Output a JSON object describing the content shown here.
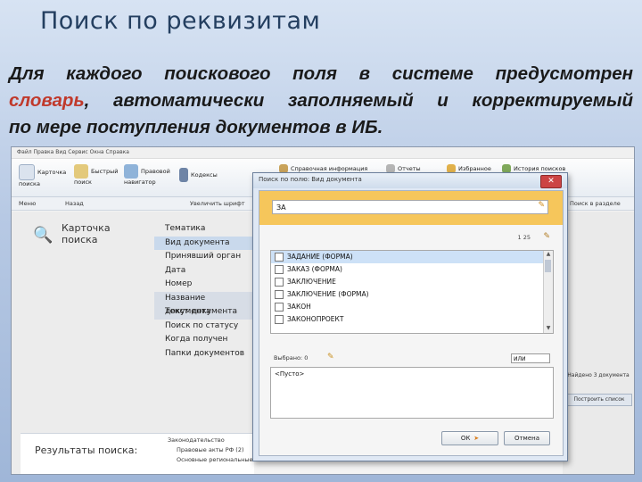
{
  "slide": {
    "title": "Поиск по реквизитам",
    "intro_line1": "Для каждого поискового поля в системе предусмотрен",
    "intro_line2_hl": "словарь",
    "intro_line2_rest": ", автоматически заполняемый и корректируемый",
    "intro_line3": "по мере поступления документов в ИБ."
  },
  "app": {
    "ribbon": {
      "card": "Карточка поиска",
      "quick": "Быстрый поиск",
      "legal": "Правовой навигатор",
      "codes": "Кодексы",
      "reference": "Справочная информация",
      "reports": "Отчеты",
      "favorites": "Избранное",
      "history": "История поисков"
    },
    "toolbar": {
      "menu": "Меню",
      "back": "Назад",
      "zoom": "Увеличить шрифт",
      "search_section": "Поиск в разделе"
    },
    "card_title": "Карточка поиска",
    "fields": [
      "Тематика",
      "Вид документа",
      "Принявший орган",
      "Дата",
      "Номер",
      "Название документа",
      "Текст документа",
      "Поиск по статусу",
      "Когда получен",
      "Папки документов"
    ],
    "results_label": "Результаты поиска:",
    "tree": [
      "Законодательство",
      "Правовые акты РФ (2)",
      "Основные региональные"
    ],
    "right_found": "Найдено 3 документа",
    "right_build": "Построить список"
  },
  "dialog": {
    "title": "Поиск по полю: Вид документа",
    "search_value": "ЗА",
    "counter": "1  25",
    "items": [
      "ЗАДАНИЕ (ФОРМА)",
      "ЗАКАЗ (ФОРМА)",
      "ЗАКЛЮЧЕНИЕ",
      "ЗАКЛЮЧЕНИЕ (ФОРМА)",
      "ЗАКОН",
      "ЗАКОНОПРОЕКТ"
    ],
    "selected_label": "Выбрано: 0",
    "combo": "ИЛИ",
    "chosen": "<Пусто>",
    "ok": "ОК",
    "cancel": "Отмена"
  }
}
